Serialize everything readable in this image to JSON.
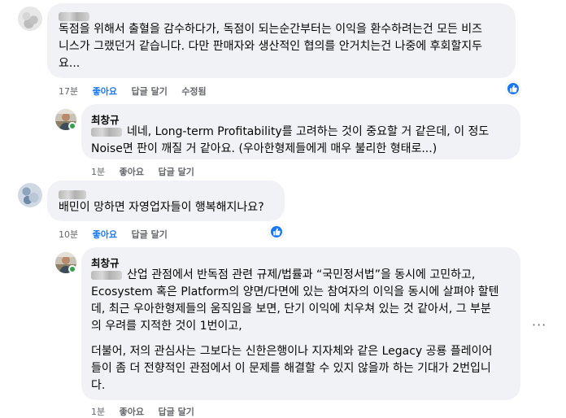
{
  "comments": [
    {
      "lines": [
        "독점을 위해서 출혈을 감수하다가, 독점이 되는순간부터는 이익을 환수하려는건 모든 비즈",
        "니스가 그랬던거 같습니다. 다만 판매자와 생산적인 협의를 안거치는건 나중에 후회할지두",
        "요..."
      ],
      "time": "17분",
      "like": "좋아요",
      "reply": "답글 달기",
      "edited": "수정됨"
    },
    {
      "author": "최창규",
      "lines": [
        "네네, Long-term Profitability를 고려하는 것이 중요할 거 같은데, 이 정도",
        "Noise면 판이 깨질 거 같아요. (우아한형제들에게 매우 불리한 형태로...)"
      ],
      "time": "1분",
      "like": "좋아요",
      "reply": "답글 달기"
    },
    {
      "lines": [
        "배민이 망하면 자영업자들이 행복해지나요?"
      ],
      "time": "10분",
      "like": "좋아요",
      "reply": "답글 달기"
    },
    {
      "author": "최창규",
      "lines": [
        "산업 관점에서 반독점 관련 규제/법률과 “국민정서법”을 동시에 고민하고,",
        "Ecosystem 혹은 Platform의 양면/다면에 있는 참여자의 이익을 동시에 살펴야 할텐",
        "데,  최근 우아한형제들의 움직임을 보면, 단기 이익에 치우쳐 있는 것 같아서, 그 부분",
        "의 우려를 지적한 것이 1번이고,",
        "",
        "더불어, 저의 관심사는 그보다는 신한은행이나 지자체와 같은 Legacy 공룡 플레이어",
        "들이 좀 더 전향적인 관점에서 이 문제를 해결할 수 있지 않을까 하는 기대가 2번입니",
        "다."
      ],
      "time": "1분",
      "like": "좋아요",
      "reply": "답글 달기"
    }
  ],
  "colors": {
    "bubble": "#f0f2f5",
    "meta": "#65676b",
    "like_active": "#1877f2",
    "online": "#31a24c"
  },
  "icons": [
    "like-reaction-icon",
    "more-options-icon",
    "online-status-icon"
  ]
}
